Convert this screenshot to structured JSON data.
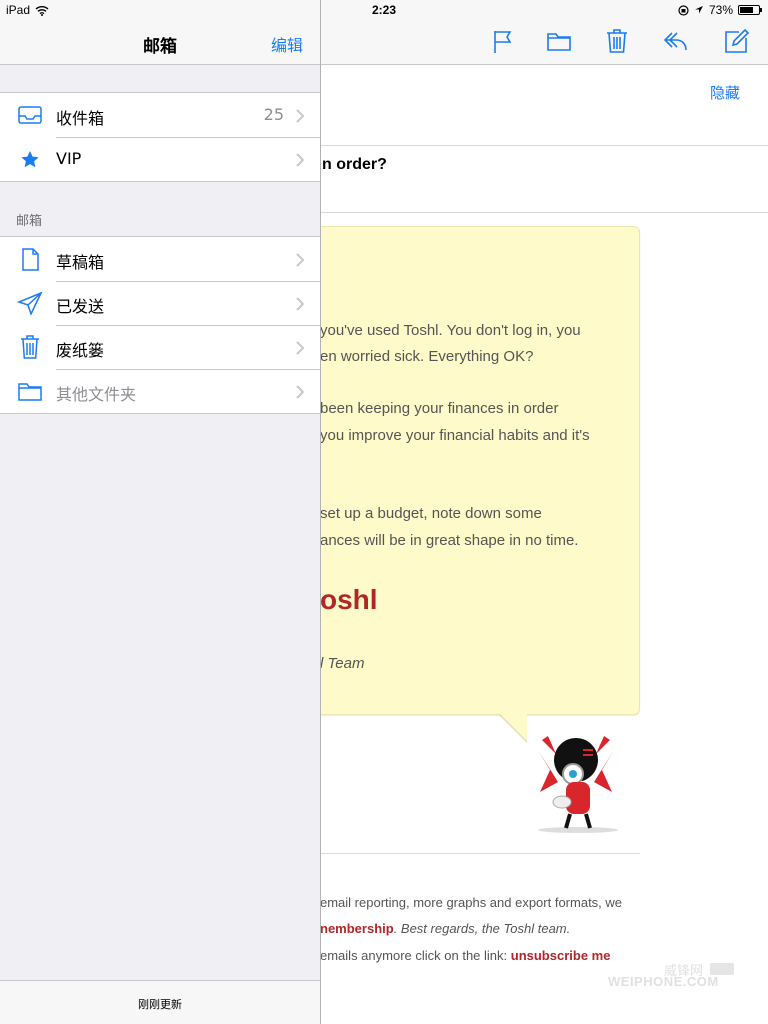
{
  "status_bar": {
    "device": "iPad",
    "time": "2:23",
    "battery_text": "73%",
    "battery_level": 0.73
  },
  "sidebar": {
    "title": "邮箱",
    "edit_label": "编辑",
    "top_items": [
      {
        "label": "收件箱",
        "count": "25",
        "icon": "inbox-icon"
      },
      {
        "label": "VIP",
        "count": "",
        "icon": "star-icon"
      }
    ],
    "section_header": "邮箱",
    "mailbox_items": [
      {
        "label": "草稿箱",
        "icon": "draft-icon"
      },
      {
        "label": "已发送",
        "icon": "sent-icon"
      },
      {
        "label": "废纸篓",
        "icon": "trash-icon"
      },
      {
        "label": "其他文件夹",
        "icon": "folder-icon"
      }
    ],
    "updated_text": "刚刚更新"
  },
  "toolbar": {
    "icons": [
      "flag-icon",
      "folder-icon",
      "trash-icon",
      "reply-icon",
      "compose-icon"
    ],
    "accent_color": "#1b7cf0"
  },
  "message": {
    "hide_label": "隐藏",
    "subject": "n order?",
    "body_lines": [
      "you've used Toshl. You don't log in, you",
      "en worried sick. Everything OK?",
      "been keeping your finances in order",
      "you improve your financial habits and it's",
      "set up a budget, note down some",
      "ances will be in great shape in no time."
    ],
    "logo_word": "oshl",
    "team_line": "l Team",
    "footer": {
      "line1": "email reporting, more graphs and export formats, we",
      "line2_link": "nembership",
      "line2_rest": ". Best regards, the Toshl team.",
      "line3_text": "emails anymore click on the link: ",
      "line3_link": "unsubscribe me"
    },
    "brand_color": "#b0262a",
    "card_color": "#fefac9"
  },
  "watermark": {
    "top": "威锋网",
    "badge": "",
    "bottom": "WEIPHONE.COM"
  }
}
